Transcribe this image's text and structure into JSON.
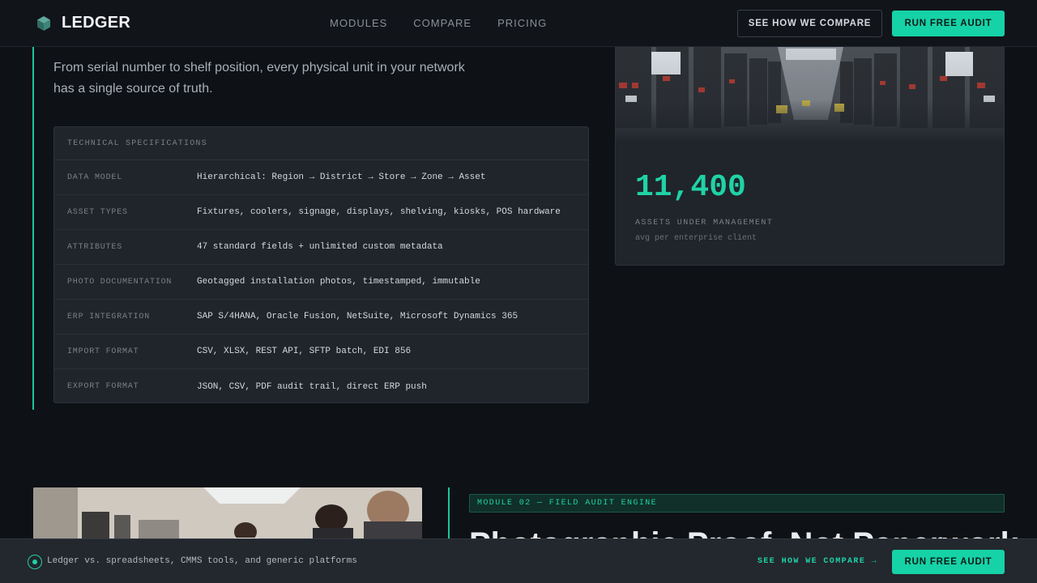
{
  "header": {
    "brand": "LEDGER",
    "nav": [
      "MODULES",
      "COMPARE",
      "PRICING"
    ],
    "compare_button": "SEE HOW WE COMPARE",
    "audit_button": "RUN FREE AUDIT"
  },
  "intro": {
    "lead_line1": "From serial number to shelf position, every physical unit in your network",
    "lead_line2": "has a single source of truth."
  },
  "specs": {
    "title": "TECHNICAL SPECIFICATIONS",
    "rows": [
      {
        "key": "DATA MODEL",
        "value": "Hierarchical: Region → District → Store → Zone → Asset"
      },
      {
        "key": "ASSET TYPES",
        "value": "Fixtures, coolers, signage, displays, shelving, kiosks, POS hardware"
      },
      {
        "key": "ATTRIBUTES",
        "value": "47 standard fields + unlimited custom metadata"
      },
      {
        "key": "PHOTO DOCUMENTATION",
        "value": "Geotagged installation photos, timestamped, immutable"
      },
      {
        "key": "ERP INTEGRATION",
        "value": "SAP S/4HANA, Oracle Fusion, NetSuite, Microsoft Dynamics 365"
      },
      {
        "key": "IMPORT FORMAT",
        "value": "CSV, XLSX, REST API, SFTP batch, EDI 856"
      },
      {
        "key": "EXPORT FORMAT",
        "value": "JSON, CSV, PDF audit trail, direct ERP push"
      }
    ]
  },
  "stat": {
    "value": "11,400",
    "label": "ASSETS UNDER MANAGEMENT",
    "sub": "avg per enterprise client"
  },
  "module2": {
    "tag": "MODULE 02 — FIELD AUDIT ENGINE",
    "title": "Photographic Proof, Not Paperwork"
  },
  "bottombar": {
    "text": "Ledger vs. spreadsheets, CMMS tools, and generic platforms",
    "link": "SEE HOW WE COMPARE →",
    "button": "RUN FREE AUDIT"
  },
  "colors": {
    "accent": "#16d2a7",
    "background": "#0e1115",
    "card": "#20242b"
  }
}
